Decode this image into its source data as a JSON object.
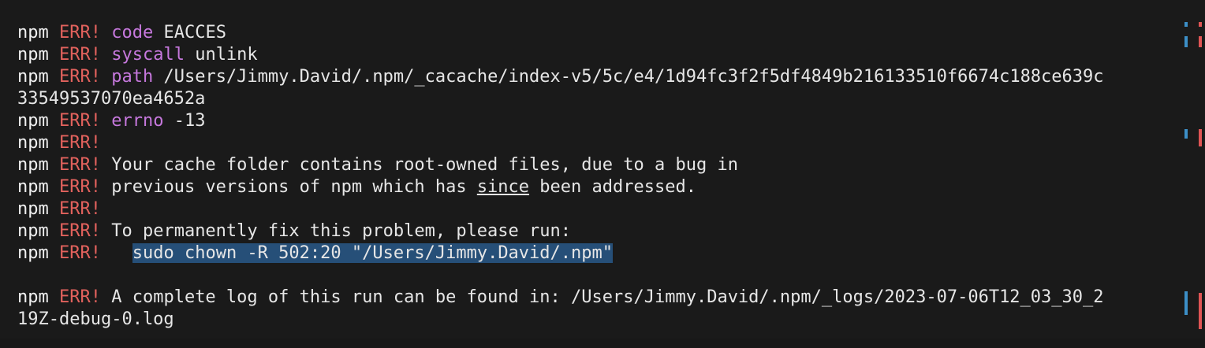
{
  "terminal": {
    "lines": [
      {
        "prefix": "npm",
        "err": "ERR!",
        "key": "code",
        "rest": " EACCES"
      },
      {
        "prefix": "npm",
        "err": "ERR!",
        "key": "syscall",
        "rest": " unlink"
      },
      {
        "prefix": "npm",
        "err": "ERR!",
        "key": "path",
        "rest": " /Users/Jimmy.David/.npm/_cacache/index-v5/5c/e4/1d94fc3f2f5df4849b216133510f6674c188ce639c"
      },
      {
        "prefix": "",
        "err": "",
        "key": "",
        "rest": "33549537070ea4652a"
      },
      {
        "prefix": "npm",
        "err": "ERR!",
        "key": "errno",
        "rest": " -13"
      },
      {
        "prefix": "npm",
        "err": "ERR!",
        "key": "",
        "rest": ""
      },
      {
        "prefix": "npm",
        "err": "ERR!",
        "key": "",
        "rest": " Your cache folder contains root-owned files, due to a bug in"
      },
      {
        "prefix": "npm",
        "err": "ERR!",
        "key": "",
        "rest_a": " previous versions of npm which has ",
        "underline": "since",
        "rest_b": " been addressed."
      },
      {
        "prefix": "npm",
        "err": "ERR!",
        "key": "",
        "rest": ""
      },
      {
        "prefix": "npm",
        "err": "ERR!",
        "key": "",
        "rest": " To permanently fix this problem, please run:"
      },
      {
        "prefix": "npm",
        "err": "ERR!",
        "key": "",
        "indent": "   ",
        "selected": "sudo chown -R 502:20 \"/Users/Jimmy.David/.npm\""
      },
      {
        "prefix": "",
        "err": "",
        "key": "",
        "rest": ""
      },
      {
        "prefix": "npm",
        "err": "ERR!",
        "key": "",
        "rest": " A complete log of this run can be found in: /Users/Jimmy.David/.npm/_logs/2023-07-06T12_03_30_2"
      },
      {
        "prefix": "",
        "err": "",
        "key": "",
        "rest": "19Z-debug-0.log"
      }
    ]
  },
  "colors": {
    "background": "#1a1a1a",
    "err": "#e2625d",
    "keyword": "#c678dd",
    "selection": "#264f78",
    "ruler_blue": "#3c8fc7",
    "ruler_red": "#e05555"
  }
}
